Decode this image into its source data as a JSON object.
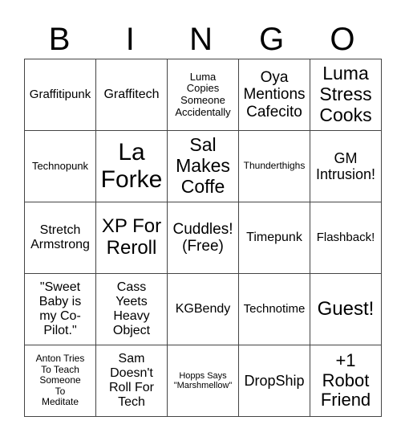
{
  "header": [
    "B",
    "I",
    "N",
    "G",
    "O"
  ],
  "cells": [
    [
      {
        "text": "Graffitipunk",
        "size": 15
      },
      {
        "text": "Graffitech",
        "size": 16
      },
      {
        "text": "Luma\nCopies\nSomeone\nAccidentally",
        "size": 13
      },
      {
        "text": "Oya\nMentions\nCafecito",
        "size": 19
      },
      {
        "text": "Luma\nStress\nCooks",
        "size": 23
      }
    ],
    [
      {
        "text": "Technopunk",
        "size": 13
      },
      {
        "text": "La\nForke",
        "size": 30
      },
      {
        "text": "Sal\nMakes\nCoffe",
        "size": 23
      },
      {
        "text": "Thunderthighs",
        "size": 12
      },
      {
        "text": "GM\nIntrusion!",
        "size": 18
      }
    ],
    [
      {
        "text": "Stretch\nArmstrong",
        "size": 16
      },
      {
        "text": "XP For\nReroll",
        "size": 24
      },
      {
        "text": "Cuddles!\n(Free)",
        "size": 19
      },
      {
        "text": "Timepunk",
        "size": 16
      },
      {
        "text": "Flashback!",
        "size": 15
      }
    ],
    [
      {
        "text": "\"Sweet\nBaby is\nmy Co-\nPilot.\"",
        "size": 16
      },
      {
        "text": "Cass\nYeets\nHeavy\nObject",
        "size": 16
      },
      {
        "text": "KGBendy",
        "size": 16
      },
      {
        "text": "Technotime",
        "size": 15
      },
      {
        "text": "Guest!",
        "size": 24
      }
    ],
    [
      {
        "text": "Anton Tries\nTo Teach\nSomeone\nTo\nMeditate",
        "size": 12
      },
      {
        "text": "Sam\nDoesn't\nRoll For\nTech",
        "size": 16
      },
      {
        "text": "Hopps Says\n\"Marshmellow\"",
        "size": 11
      },
      {
        "text": "DropShip",
        "size": 18
      },
      {
        "text": "+1\nRobot\nFriend",
        "size": 22
      }
    ]
  ]
}
